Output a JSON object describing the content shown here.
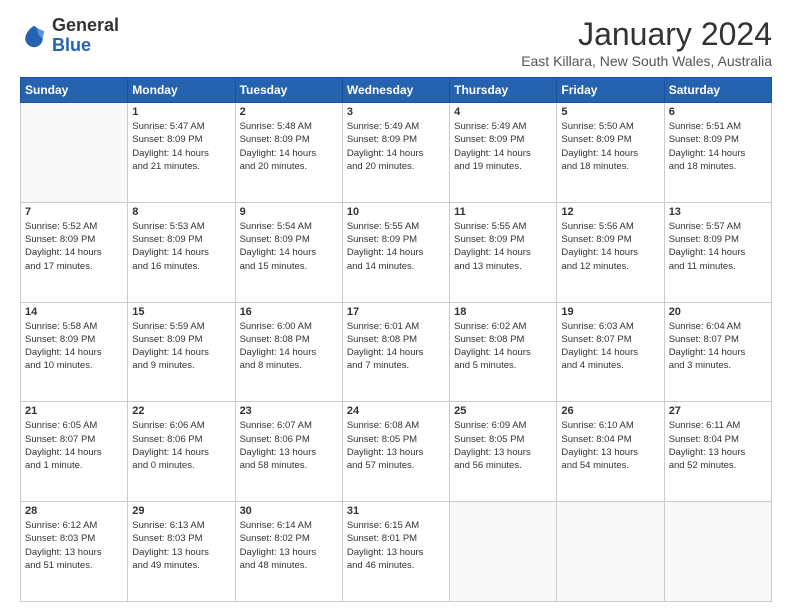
{
  "logo": {
    "general": "General",
    "blue": "Blue"
  },
  "header": {
    "month_year": "January 2024",
    "location": "East Killara, New South Wales, Australia"
  },
  "days_of_week": [
    "Sunday",
    "Monday",
    "Tuesday",
    "Wednesday",
    "Thursday",
    "Friday",
    "Saturday"
  ],
  "weeks": [
    [
      {
        "day": "",
        "content": ""
      },
      {
        "day": "1",
        "content": "Sunrise: 5:47 AM\nSunset: 8:09 PM\nDaylight: 14 hours\nand 21 minutes."
      },
      {
        "day": "2",
        "content": "Sunrise: 5:48 AM\nSunset: 8:09 PM\nDaylight: 14 hours\nand 20 minutes."
      },
      {
        "day": "3",
        "content": "Sunrise: 5:49 AM\nSunset: 8:09 PM\nDaylight: 14 hours\nand 20 minutes."
      },
      {
        "day": "4",
        "content": "Sunrise: 5:49 AM\nSunset: 8:09 PM\nDaylight: 14 hours\nand 19 minutes."
      },
      {
        "day": "5",
        "content": "Sunrise: 5:50 AM\nSunset: 8:09 PM\nDaylight: 14 hours\nand 18 minutes."
      },
      {
        "day": "6",
        "content": "Sunrise: 5:51 AM\nSunset: 8:09 PM\nDaylight: 14 hours\nand 18 minutes."
      }
    ],
    [
      {
        "day": "7",
        "content": "Sunrise: 5:52 AM\nSunset: 8:09 PM\nDaylight: 14 hours\nand 17 minutes."
      },
      {
        "day": "8",
        "content": "Sunrise: 5:53 AM\nSunset: 8:09 PM\nDaylight: 14 hours\nand 16 minutes."
      },
      {
        "day": "9",
        "content": "Sunrise: 5:54 AM\nSunset: 8:09 PM\nDaylight: 14 hours\nand 15 minutes."
      },
      {
        "day": "10",
        "content": "Sunrise: 5:55 AM\nSunset: 8:09 PM\nDaylight: 14 hours\nand 14 minutes."
      },
      {
        "day": "11",
        "content": "Sunrise: 5:55 AM\nSunset: 8:09 PM\nDaylight: 14 hours\nand 13 minutes."
      },
      {
        "day": "12",
        "content": "Sunrise: 5:56 AM\nSunset: 8:09 PM\nDaylight: 14 hours\nand 12 minutes."
      },
      {
        "day": "13",
        "content": "Sunrise: 5:57 AM\nSunset: 8:09 PM\nDaylight: 14 hours\nand 11 minutes."
      }
    ],
    [
      {
        "day": "14",
        "content": "Sunrise: 5:58 AM\nSunset: 8:09 PM\nDaylight: 14 hours\nand 10 minutes."
      },
      {
        "day": "15",
        "content": "Sunrise: 5:59 AM\nSunset: 8:09 PM\nDaylight: 14 hours\nand 9 minutes."
      },
      {
        "day": "16",
        "content": "Sunrise: 6:00 AM\nSunset: 8:08 PM\nDaylight: 14 hours\nand 8 minutes."
      },
      {
        "day": "17",
        "content": "Sunrise: 6:01 AM\nSunset: 8:08 PM\nDaylight: 14 hours\nand 7 minutes."
      },
      {
        "day": "18",
        "content": "Sunrise: 6:02 AM\nSunset: 8:08 PM\nDaylight: 14 hours\nand 5 minutes."
      },
      {
        "day": "19",
        "content": "Sunrise: 6:03 AM\nSunset: 8:07 PM\nDaylight: 14 hours\nand 4 minutes."
      },
      {
        "day": "20",
        "content": "Sunrise: 6:04 AM\nSunset: 8:07 PM\nDaylight: 14 hours\nand 3 minutes."
      }
    ],
    [
      {
        "day": "21",
        "content": "Sunrise: 6:05 AM\nSunset: 8:07 PM\nDaylight: 14 hours\nand 1 minute."
      },
      {
        "day": "22",
        "content": "Sunrise: 6:06 AM\nSunset: 8:06 PM\nDaylight: 14 hours\nand 0 minutes."
      },
      {
        "day": "23",
        "content": "Sunrise: 6:07 AM\nSunset: 8:06 PM\nDaylight: 13 hours\nand 58 minutes."
      },
      {
        "day": "24",
        "content": "Sunrise: 6:08 AM\nSunset: 8:05 PM\nDaylight: 13 hours\nand 57 minutes."
      },
      {
        "day": "25",
        "content": "Sunrise: 6:09 AM\nSunset: 8:05 PM\nDaylight: 13 hours\nand 56 minutes."
      },
      {
        "day": "26",
        "content": "Sunrise: 6:10 AM\nSunset: 8:04 PM\nDaylight: 13 hours\nand 54 minutes."
      },
      {
        "day": "27",
        "content": "Sunrise: 6:11 AM\nSunset: 8:04 PM\nDaylight: 13 hours\nand 52 minutes."
      }
    ],
    [
      {
        "day": "28",
        "content": "Sunrise: 6:12 AM\nSunset: 8:03 PM\nDaylight: 13 hours\nand 51 minutes."
      },
      {
        "day": "29",
        "content": "Sunrise: 6:13 AM\nSunset: 8:03 PM\nDaylight: 13 hours\nand 49 minutes."
      },
      {
        "day": "30",
        "content": "Sunrise: 6:14 AM\nSunset: 8:02 PM\nDaylight: 13 hours\nand 48 minutes."
      },
      {
        "day": "31",
        "content": "Sunrise: 6:15 AM\nSunset: 8:01 PM\nDaylight: 13 hours\nand 46 minutes."
      },
      {
        "day": "",
        "content": ""
      },
      {
        "day": "",
        "content": ""
      },
      {
        "day": "",
        "content": ""
      }
    ]
  ]
}
